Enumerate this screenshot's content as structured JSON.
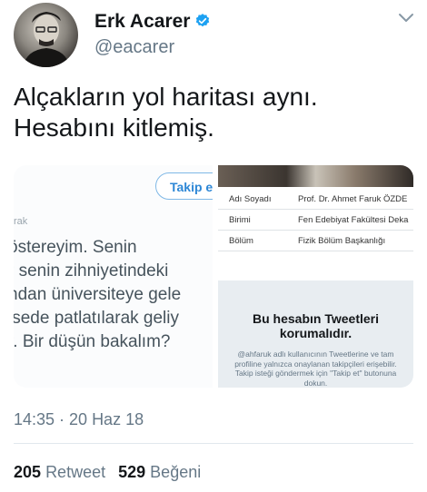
{
  "author": {
    "display_name": "Erk Acarer",
    "handle": "@eacarer",
    "verified": true,
    "avatar_icon": "profile-photo"
  },
  "tweet": {
    "lines": [
      "Alçakların yol haritası aynı.",
      "Hesabını kitlemiş."
    ]
  },
  "media_left": {
    "follow_label": "Takip e",
    "sub_label": "rak",
    "lines": [
      "östereyim. Senin",
      "r senin zihniyetindeki",
      "ndan üniversiteye gele",
      "isede patlatılarak geliy",
      "r. Bir düşün bakalım?"
    ]
  },
  "media_right_top": {
    "rows": [
      {
        "label": "Adı Soyadı",
        "value": "Prof. Dr. Ahmet Faruk ÖZDE"
      },
      {
        "label": "Birimi",
        "value": "Fen Edebiyat Fakültesi Deka"
      },
      {
        "label": "Bölüm",
        "value": "Fizik Bölüm Başkanlığı"
      }
    ]
  },
  "media_right_bottom": {
    "title": "Bu hesabın Tweetleri korumalıdır.",
    "description": "@ahfaruk adlı kullanıcının Tweetlerine ve tam profiline yalnızca onaylanan takipçileri erişebilir. Takip isteği göndermek için \"Takip et\" butonuna dokun."
  },
  "meta": {
    "timestamp": "14:35 · 20 Haz 18"
  },
  "stats": {
    "retweet_count": "205",
    "retweet_label": "Retweet",
    "like_count": "529",
    "like_label": "Beğeni"
  },
  "colors": {
    "verified_blue": "#1da1f2",
    "secondary_text": "#657786",
    "protected_bg": "#e8edf1"
  }
}
